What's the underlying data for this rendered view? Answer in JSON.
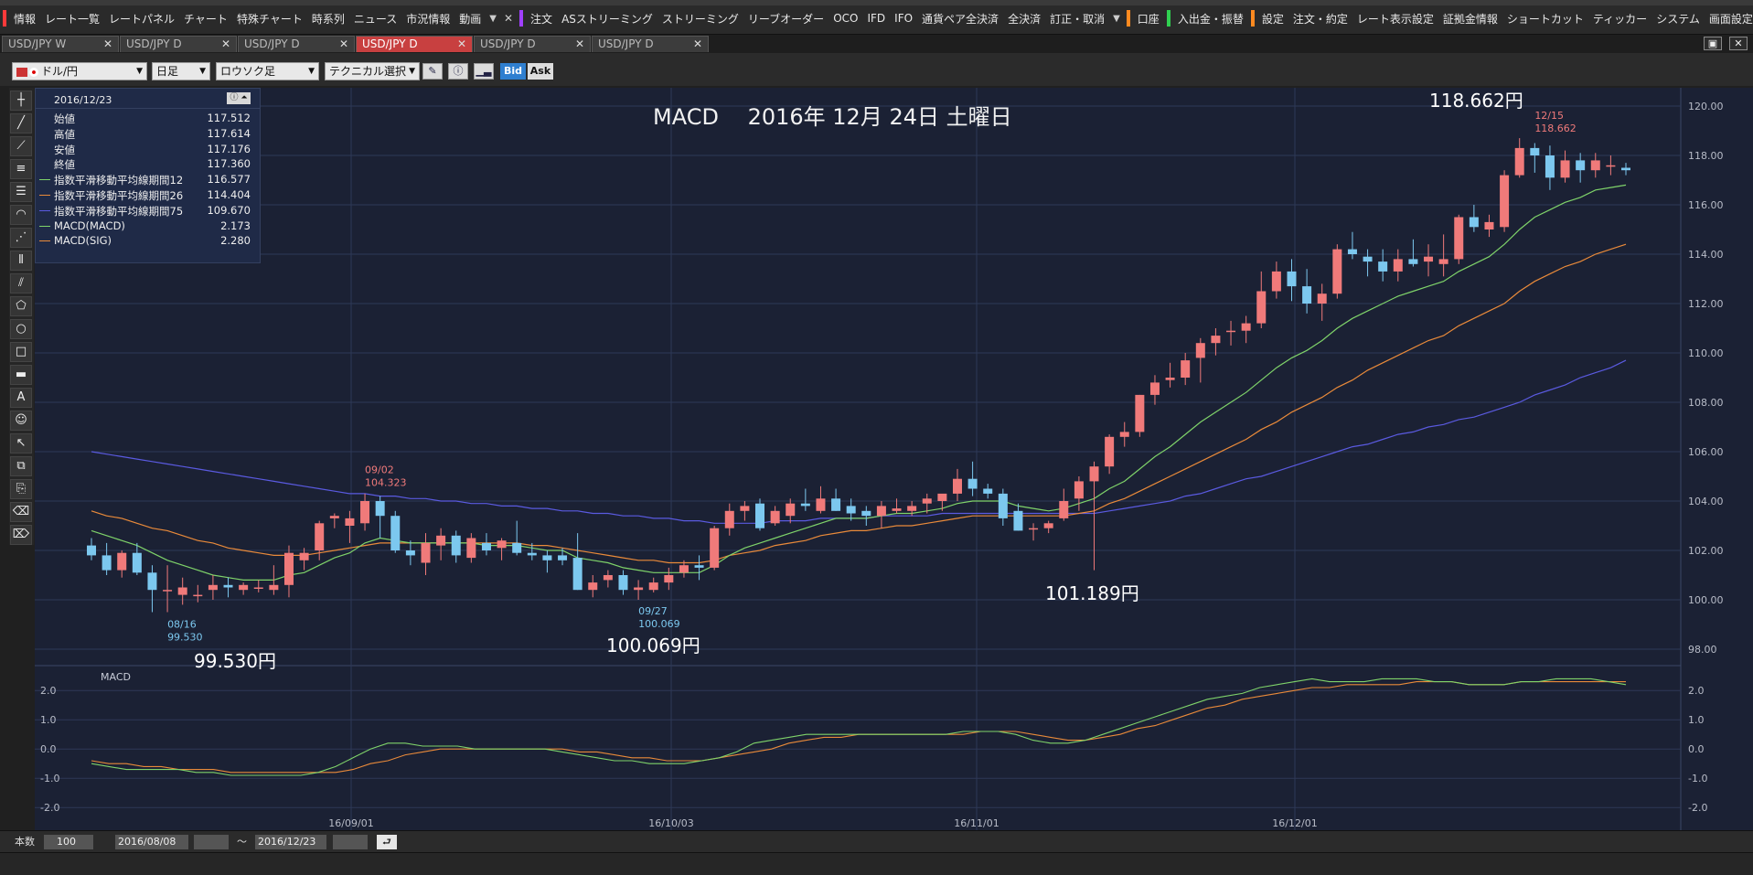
{
  "menu": {
    "items": [
      {
        "label": "情報",
        "sep_before": "#ff3a3a"
      },
      {
        "label": "レート一覧"
      },
      {
        "label": "レートパネル"
      },
      {
        "label": "チャート"
      },
      {
        "label": "特殊チャート"
      },
      {
        "label": "時系列"
      },
      {
        "label": "ニュース"
      },
      {
        "label": "市況情報"
      },
      {
        "label": "動画"
      },
      {
        "label": "注文",
        "sep_before": "#a040ff"
      },
      {
        "label": "ASストリーミング"
      },
      {
        "label": "ストリーミング"
      },
      {
        "label": "リーブオーダー"
      },
      {
        "label": "OCO"
      },
      {
        "label": "IFD"
      },
      {
        "label": "IFO"
      },
      {
        "label": "通貨ペア全決済"
      },
      {
        "label": "全決済"
      },
      {
        "label": "訂正・取消"
      },
      {
        "label": "口座",
        "sep_before": "#ff8a20"
      },
      {
        "label": "入出金・振替",
        "sep_before": "#30d050"
      },
      {
        "label": "設定",
        "sep_before": "#ff8a20"
      },
      {
        "label": "注文・約定"
      },
      {
        "label": "レート表示設定"
      },
      {
        "label": "証拠金情報"
      },
      {
        "label": "ショートカット"
      },
      {
        "label": "ティッカー"
      },
      {
        "label": "システム"
      },
      {
        "label": "画面設定"
      },
      {
        "label": "チャート"
      }
    ]
  },
  "tabs": [
    {
      "label": "USD/JPY W",
      "active": false
    },
    {
      "label": "USD/JPY D",
      "active": false
    },
    {
      "label": "USD/JPY D",
      "active": false
    },
    {
      "label": "USD/JPY D",
      "active": true
    },
    {
      "label": "USD/JPY D",
      "active": false
    },
    {
      "label": "USD/JPY D",
      "active": false
    }
  ],
  "toolbar": {
    "pair": "ドル/円",
    "period": "日足",
    "style": "ロウソク足",
    "technical": "テクニカル選択",
    "bid": "Bid",
    "ask": "Ask"
  },
  "info": {
    "date": "2016/12/23",
    "rows": [
      {
        "label": "始値",
        "value": "117.512",
        "color": ""
      },
      {
        "label": "高値",
        "value": "117.614",
        "color": ""
      },
      {
        "label": "安値",
        "value": "117.176",
        "color": ""
      },
      {
        "label": "終値",
        "value": "117.360",
        "color": ""
      },
      {
        "label": "指数平滑移動平均線期間12",
        "value": "116.577",
        "color": "#7fd36a"
      },
      {
        "label": "指数平滑移動平均線期間26",
        "value": "114.404",
        "color": "#e98a3a"
      },
      {
        "label": "指数平滑移動平均線期間75",
        "value": "109.670",
        "color": "#5a5ae0"
      },
      {
        "label": "MACD(MACD)",
        "value": "2.173",
        "color": "#7fd36a"
      },
      {
        "label": "MACD(SIG)",
        "value": "2.280",
        "color": "#e98a3a"
      }
    ]
  },
  "chart_data": {
    "type": "candlestick",
    "title": "MACD　 2016年 12月 24日 土曜日",
    "price_axis": {
      "ylim": [
        98,
        120
      ],
      "ticks": [
        "98.00",
        "100.00",
        "102.00",
        "104.00",
        "106.00",
        "108.00",
        "110.00",
        "112.00",
        "114.00",
        "116.00",
        "118.00",
        "120.00"
      ]
    },
    "x_axis": {
      "ticks": [
        "16/09/01",
        "16/10/03",
        "16/11/01",
        "16/12/01"
      ]
    },
    "candles": [
      [
        102.2,
        102.5,
        101.6,
        101.8
      ],
      [
        101.8,
        102.3,
        101.0,
        101.2
      ],
      [
        101.2,
        102.0,
        100.9,
        101.9
      ],
      [
        101.9,
        102.3,
        101.0,
        101.1
      ],
      [
        101.1,
        101.4,
        99.5,
        100.4
      ],
      [
        100.4,
        101.4,
        99.5,
        100.4
      ],
      [
        100.2,
        100.9,
        99.8,
        100.5
      ],
      [
        100.2,
        100.6,
        99.9,
        100.2
      ],
      [
        100.4,
        101.0,
        100.0,
        100.6
      ],
      [
        100.6,
        100.9,
        100.1,
        100.5
      ],
      [
        100.4,
        100.7,
        100.2,
        100.6
      ],
      [
        100.5,
        100.8,
        100.3,
        100.5
      ],
      [
        100.4,
        101.4,
        100.2,
        100.6
      ],
      [
        100.6,
        102.2,
        100.1,
        101.9
      ],
      [
        101.6,
        102.1,
        101.2,
        101.9
      ],
      [
        102.0,
        103.2,
        101.6,
        103.1
      ],
      [
        103.3,
        103.5,
        102.9,
        103.4
      ],
      [
        103.0,
        103.6,
        102.3,
        103.3
      ],
      [
        103.1,
        104.3,
        102.8,
        104.0
      ],
      [
        104.0,
        104.2,
        102.5,
        103.4
      ],
      [
        103.4,
        103.6,
        101.9,
        102.0
      ],
      [
        102.0,
        102.4,
        101.4,
        101.8
      ],
      [
        101.5,
        102.7,
        101.0,
        102.3
      ],
      [
        102.2,
        102.9,
        101.6,
        102.6
      ],
      [
        102.6,
        102.8,
        101.5,
        101.8
      ],
      [
        101.7,
        102.7,
        101.5,
        102.5
      ],
      [
        102.3,
        102.7,
        101.8,
        102.0
      ],
      [
        102.1,
        102.5,
        101.6,
        102.4
      ],
      [
        102.3,
        103.2,
        101.8,
        101.9
      ],
      [
        101.9,
        102.3,
        101.6,
        101.8
      ],
      [
        101.8,
        102.0,
        101.1,
        101.6
      ],
      [
        101.8,
        102.1,
        101.4,
        101.6
      ],
      [
        101.7,
        102.7,
        100.4,
        100.4
      ],
      [
        100.4,
        101.0,
        100.1,
        100.7
      ],
      [
        100.8,
        101.2,
        100.5,
        101.0
      ],
      [
        101.0,
        101.2,
        100.2,
        100.4
      ],
      [
        100.4,
        100.8,
        100.0,
        100.5
      ],
      [
        100.4,
        100.9,
        100.3,
        100.7
      ],
      [
        100.7,
        101.3,
        100.4,
        101.0
      ],
      [
        101.1,
        101.6,
        100.9,
        101.4
      ],
      [
        101.4,
        101.8,
        100.8,
        101.3
      ],
      [
        101.3,
        103.0,
        101.2,
        102.9
      ],
      [
        102.9,
        103.9,
        102.6,
        103.6
      ],
      [
        103.6,
        104.0,
        103.2,
        103.8
      ],
      [
        103.9,
        104.1,
        102.8,
        102.9
      ],
      [
        103.1,
        103.8,
        103.0,
        103.6
      ],
      [
        103.4,
        104.1,
        103.1,
        103.9
      ],
      [
        103.9,
        104.5,
        103.6,
        103.8
      ],
      [
        103.6,
        104.6,
        103.5,
        104.1
      ],
      [
        104.1,
        104.5,
        103.6,
        103.6
      ],
      [
        103.8,
        104.1,
        103.2,
        103.5
      ],
      [
        103.6,
        103.8,
        103.0,
        103.4
      ],
      [
        103.4,
        104.0,
        102.9,
        103.8
      ],
      [
        103.6,
        104.1,
        103.5,
        103.7
      ],
      [
        103.6,
        104.0,
        103.4,
        103.8
      ],
      [
        103.9,
        104.3,
        103.5,
        104.1
      ],
      [
        104.0,
        104.2,
        103.6,
        104.3
      ],
      [
        104.3,
        105.3,
        104.0,
        104.9
      ],
      [
        104.9,
        105.6,
        104.2,
        104.5
      ],
      [
        104.5,
        104.7,
        104.1,
        104.3
      ],
      [
        104.3,
        104.5,
        103.0,
        103.3
      ],
      [
        103.6,
        103.9,
        102.8,
        102.8
      ],
      [
        102.9,
        103.1,
        102.4,
        102.9
      ],
      [
        102.9,
        103.2,
        102.7,
        103.1
      ],
      [
        103.3,
        104.5,
        103.2,
        104.0
      ],
      [
        104.1,
        105.0,
        103.6,
        104.8
      ],
      [
        104.8,
        105.6,
        101.2,
        105.4
      ],
      [
        105.4,
        106.7,
        105.1,
        106.6
      ],
      [
        106.6,
        107.2,
        106.2,
        106.8
      ],
      [
        106.8,
        108.3,
        106.6,
        108.3
      ],
      [
        108.3,
        109.1,
        107.9,
        108.8
      ],
      [
        108.9,
        109.6,
        108.6,
        109.0
      ],
      [
        109.0,
        110.0,
        108.7,
        109.7
      ],
      [
        109.8,
        110.6,
        108.8,
        110.4
      ],
      [
        110.4,
        111.0,
        109.9,
        110.7
      ],
      [
        110.9,
        111.3,
        110.3,
        110.9
      ],
      [
        110.9,
        111.5,
        110.4,
        111.2
      ],
      [
        111.2,
        113.3,
        111.0,
        112.5
      ],
      [
        112.5,
        113.7,
        112.2,
        113.3
      ],
      [
        113.3,
        113.8,
        112.1,
        112.7
      ],
      [
        112.7,
        113.4,
        111.6,
        112.0
      ],
      [
        112.0,
        112.8,
        111.3,
        112.4
      ],
      [
        112.4,
        114.4,
        112.2,
        114.2
      ],
      [
        114.2,
        114.9,
        113.8,
        114.0
      ],
      [
        113.9,
        114.2,
        113.1,
        113.7
      ],
      [
        113.7,
        114.2,
        112.9,
        113.3
      ],
      [
        113.3,
        114.2,
        112.9,
        113.8
      ],
      [
        113.8,
        114.6,
        113.5,
        113.6
      ],
      [
        113.7,
        114.4,
        113.1,
        113.9
      ],
      [
        113.6,
        114.8,
        113.1,
        113.8
      ],
      [
        113.8,
        115.6,
        113.6,
        115.5
      ],
      [
        115.5,
        116.0,
        114.9,
        115.1
      ],
      [
        115.0,
        115.6,
        114.7,
        115.3
      ],
      [
        115.1,
        117.4,
        114.9,
        117.2
      ],
      [
        117.2,
        118.7,
        117.1,
        118.3
      ],
      [
        118.3,
        118.5,
        117.3,
        118.0
      ],
      [
        118.0,
        118.4,
        116.6,
        117.1
      ],
      [
        117.1,
        118.2,
        116.9,
        117.8
      ],
      [
        117.8,
        118.1,
        116.9,
        117.4
      ],
      [
        117.4,
        118.1,
        117.1,
        117.8
      ],
      [
        117.6,
        118.0,
        117.2,
        117.6
      ],
      [
        117.5,
        117.7,
        117.2,
        117.4
      ]
    ],
    "ema12": [
      102.8,
      102.6,
      102.4,
      102.2,
      101.9,
      101.6,
      101.4,
      101.2,
      101.0,
      100.9,
      100.8,
      100.8,
      100.8,
      101.0,
      101.1,
      101.4,
      101.7,
      101.9,
      102.3,
      102.5,
      102.4,
      102.3,
      102.3,
      102.3,
      102.3,
      102.3,
      102.2,
      102.2,
      102.2,
      102.1,
      102.0,
      102.0,
      101.7,
      101.6,
      101.5,
      101.3,
      101.2,
      101.1,
      101.1,
      101.1,
      101.1,
      101.4,
      101.8,
      102.1,
      102.3,
      102.5,
      102.7,
      102.9,
      103.1,
      103.3,
      103.3,
      103.3,
      103.4,
      103.5,
      103.5,
      103.6,
      103.7,
      103.9,
      104.0,
      104.0,
      104.0,
      103.8,
      103.7,
      103.6,
      103.7,
      103.9,
      104.1,
      104.5,
      104.8,
      105.3,
      105.8,
      106.2,
      106.7,
      107.2,
      107.6,
      108.0,
      108.4,
      108.9,
      109.4,
      109.8,
      110.1,
      110.5,
      111.0,
      111.4,
      111.7,
      112.0,
      112.3,
      112.5,
      112.7,
      112.9,
      113.3,
      113.6,
      113.9,
      114.4,
      115.0,
      115.5,
      115.8,
      116.1,
      116.3,
      116.6,
      116.7,
      116.8
    ],
    "ema26": [
      103.6,
      103.4,
      103.3,
      103.1,
      102.9,
      102.8,
      102.6,
      102.4,
      102.3,
      102.1,
      102.0,
      101.9,
      101.8,
      101.8,
      101.8,
      101.9,
      102.0,
      102.1,
      102.2,
      102.3,
      102.3,
      102.3,
      102.3,
      102.3,
      102.3,
      102.3,
      102.3,
      102.3,
      102.3,
      102.2,
      102.2,
      102.1,
      102.0,
      101.9,
      101.8,
      101.7,
      101.6,
      101.6,
      101.5,
      101.5,
      101.5,
      101.6,
      101.8,
      101.9,
      102.0,
      102.2,
      102.3,
      102.4,
      102.6,
      102.7,
      102.8,
      102.8,
      102.9,
      103.0,
      103.0,
      103.1,
      103.2,
      103.3,
      103.4,
      103.4,
      103.4,
      103.4,
      103.4,
      103.4,
      103.4,
      103.5,
      103.6,
      103.9,
      104.1,
      104.4,
      104.7,
      105.0,
      105.3,
      105.6,
      105.9,
      106.2,
      106.5,
      106.9,
      107.2,
      107.6,
      107.9,
      108.2,
      108.6,
      108.9,
      109.3,
      109.6,
      109.9,
      110.2,
      110.5,
      110.7,
      111.1,
      111.4,
      111.7,
      112.0,
      112.5,
      112.9,
      113.2,
      113.5,
      113.7,
      114.0,
      114.2,
      114.4
    ],
    "ema75": [
      106.0,
      105.9,
      105.8,
      105.7,
      105.6,
      105.5,
      105.4,
      105.3,
      105.2,
      105.1,
      105.0,
      104.9,
      104.8,
      104.7,
      104.6,
      104.5,
      104.4,
      104.3,
      104.3,
      104.2,
      104.2,
      104.1,
      104.1,
      104.0,
      104.0,
      103.9,
      103.9,
      103.8,
      103.8,
      103.7,
      103.7,
      103.6,
      103.6,
      103.5,
      103.5,
      103.4,
      103.4,
      103.3,
      103.3,
      103.2,
      103.2,
      103.1,
      103.1,
      103.1,
      103.1,
      103.2,
      103.2,
      103.2,
      103.3,
      103.3,
      103.3,
      103.3,
      103.4,
      103.4,
      103.4,
      103.4,
      103.5,
      103.5,
      103.5,
      103.5,
      103.5,
      103.5,
      103.5,
      103.5,
      103.5,
      103.5,
      103.5,
      103.6,
      103.7,
      103.8,
      103.9,
      104.0,
      104.2,
      104.3,
      104.5,
      104.7,
      104.9,
      105.0,
      105.2,
      105.4,
      105.6,
      105.8,
      106.0,
      106.2,
      106.3,
      106.5,
      106.7,
      106.8,
      107.0,
      107.1,
      107.3,
      107.4,
      107.6,
      107.8,
      108.0,
      108.3,
      108.5,
      108.7,
      109.0,
      109.2,
      109.4,
      109.7
    ],
    "macd": {
      "ylim": [
        -2.4,
        2.6
      ],
      "ticks": [
        "2.0",
        "1.0",
        "0.0",
        "-1.0",
        "-2.0"
      ],
      "macd": [
        -0.5,
        -0.6,
        -0.7,
        -0.7,
        -0.7,
        -0.7,
        -0.8,
        -0.8,
        -0.9,
        -0.9,
        -0.9,
        -0.9,
        -0.9,
        -0.8,
        -0.6,
        -0.3,
        0.0,
        0.2,
        0.2,
        0.1,
        0.1,
        0.1,
        0.0,
        0.0,
        0.0,
        0.0,
        0.0,
        -0.1,
        -0.2,
        -0.3,
        -0.4,
        -0.4,
        -0.5,
        -0.5,
        -0.5,
        -0.4,
        -0.3,
        -0.1,
        0.2,
        0.3,
        0.4,
        0.5,
        0.5,
        0.5,
        0.5,
        0.5,
        0.5,
        0.5,
        0.5,
        0.5,
        0.6,
        0.6,
        0.6,
        0.5,
        0.3,
        0.2,
        0.2,
        0.3,
        0.5,
        0.7,
        0.9,
        1.1,
        1.3,
        1.5,
        1.7,
        1.8,
        1.9,
        2.1,
        2.2,
        2.3,
        2.4,
        2.3,
        2.3,
        2.3,
        2.4,
        2.4,
        2.4,
        2.3,
        2.3,
        2.2,
        2.2,
        2.2,
        2.3,
        2.3,
        2.4,
        2.4,
        2.4,
        2.3,
        2.2
      ],
      "signal": [
        -0.4,
        -0.5,
        -0.5,
        -0.6,
        -0.6,
        -0.7,
        -0.7,
        -0.7,
        -0.8,
        -0.8,
        -0.8,
        -0.8,
        -0.8,
        -0.8,
        -0.8,
        -0.7,
        -0.5,
        -0.4,
        -0.2,
        -0.1,
        0.0,
        0.0,
        0.0,
        0.0,
        0.0,
        0.0,
        0.0,
        0.0,
        -0.1,
        -0.1,
        -0.2,
        -0.3,
        -0.3,
        -0.4,
        -0.4,
        -0.4,
        -0.3,
        -0.2,
        -0.1,
        0.0,
        0.2,
        0.3,
        0.4,
        0.4,
        0.5,
        0.5,
        0.5,
        0.5,
        0.5,
        0.5,
        0.5,
        0.6,
        0.6,
        0.6,
        0.5,
        0.4,
        0.3,
        0.3,
        0.4,
        0.5,
        0.7,
        0.8,
        1.0,
        1.2,
        1.4,
        1.5,
        1.7,
        1.8,
        1.9,
        2.0,
        2.1,
        2.1,
        2.2,
        2.2,
        2.2,
        2.2,
        2.3,
        2.3,
        2.3,
        2.2,
        2.2,
        2.2,
        2.3,
        2.3,
        2.3,
        2.3,
        2.3,
        2.3,
        2.3
      ]
    },
    "callouts": [
      {
        "kind": "high",
        "date": "09/02",
        "price": "104.323",
        "big": ""
      },
      {
        "kind": "low",
        "date": "08/16",
        "price": "99.530",
        "big": "99.530円"
      },
      {
        "kind": "low",
        "date": "09/27",
        "price": "100.069",
        "big": "100.069円"
      },
      {
        "kind": "low",
        "date": "",
        "price": "",
        "big": "101.189円"
      },
      {
        "kind": "high",
        "date": "12/15",
        "price": "118.662",
        "big": "118.662円"
      }
    ],
    "colors": {
      "up": "#f07a7a",
      "down": "#7cc8ef",
      "ema12": "#7fd36a",
      "ema26": "#e98a3a",
      "ema75": "#5a5ae0",
      "macd": "#7fd36a",
      "signal": "#e98a3a"
    }
  },
  "macd_label": "MACD",
  "bottom": {
    "count_label": "本数",
    "count_value": "100",
    "from_date": "2016/08/08",
    "tilde": "～",
    "to_date": "2016/12/23"
  }
}
